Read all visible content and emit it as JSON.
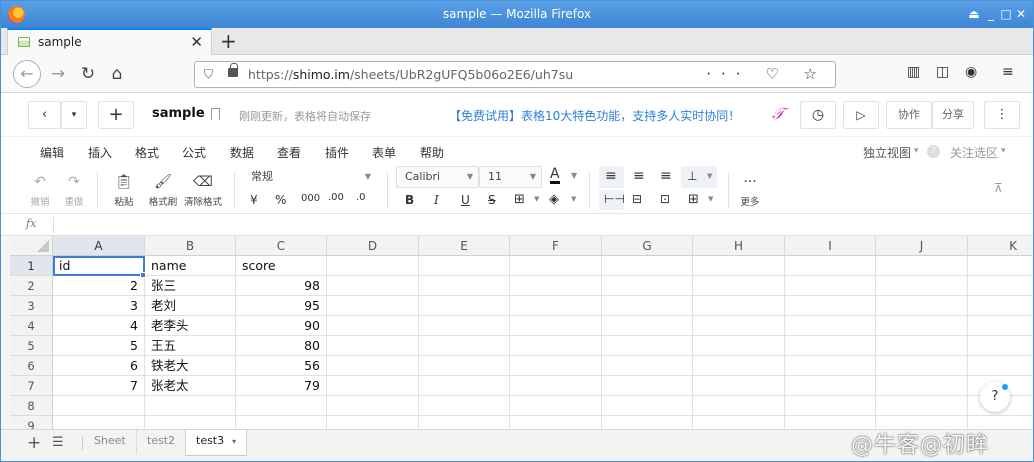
{
  "window": {
    "title": "sample — Mozilla Firefox",
    "controls": [
      "⏏",
      "_",
      "□",
      "✕"
    ]
  },
  "browser": {
    "tab": {
      "label": "sample",
      "close": "✕"
    },
    "new_tab": "+",
    "url_scheme": "https://",
    "url_host": "shimo.im",
    "url_path": "/sheets/UbR2gUFQ5b06o2E6/uh7su",
    "url_actions": "··· ♡ ☆"
  },
  "app": {
    "doc_title": "sample",
    "save_status": "刚刚更新，表格将自动保存",
    "promo": "【免费试用】表格10大特色功能，支持多人实时协同！",
    "logo_text": "𝒯",
    "collab_label": "协作",
    "share_label": "分享",
    "more_label": "⋮",
    "back_label": "‹",
    "dropdown_label": "▾",
    "add_label": "+"
  },
  "menu": {
    "items": [
      "编辑",
      "插入",
      "格式",
      "公式",
      "数据",
      "查看",
      "插件",
      "表单",
      "帮助"
    ],
    "right": {
      "view_mode": "独立视图",
      "view_arrow": "▾",
      "help_q": "?",
      "focus_label": "关注选区",
      "focus_arrow": "▾"
    }
  },
  "toolbar": {
    "undo": "撤销",
    "redo": "重做",
    "paste": "粘贴",
    "format_painter": "格式刷",
    "clear_format": "清除格式",
    "number_format": "常规",
    "currency": "¥",
    "percent": "%",
    "thousands": "000",
    "dec_increase": ".00",
    "dec_decrease": ".0",
    "font_name": "Calibri",
    "font_size": "11",
    "text_color_letter": "A",
    "bold": "B",
    "italic": "I",
    "underline": "U",
    "strike": "S",
    "more_label": "更多",
    "more_icon": "···",
    "collapse": "⊼"
  },
  "formula": {
    "fx": "fx",
    "value": ""
  },
  "sheet": {
    "columns": [
      "A",
      "B",
      "C",
      "D",
      "E",
      "F",
      "G",
      "H",
      "I",
      "J",
      "K"
    ],
    "selected_column": "A",
    "selected_row": 1,
    "rows": [
      {
        "n": "1",
        "cells": [
          "id",
          "name",
          "score"
        ]
      },
      {
        "n": "2",
        "cells": [
          "2",
          "张三",
          "98"
        ]
      },
      {
        "n": "3",
        "cells": [
          "3",
          "老刘",
          "95"
        ]
      },
      {
        "n": "4",
        "cells": [
          "4",
          "老李头",
          "90"
        ]
      },
      {
        "n": "5",
        "cells": [
          "5",
          "王五",
          "80"
        ]
      },
      {
        "n": "6",
        "cells": [
          "6",
          "铁老大",
          "56"
        ]
      },
      {
        "n": "7",
        "cells": [
          "7",
          "张老太",
          "79"
        ]
      },
      {
        "n": "8",
        "cells": [
          "",
          "",
          ""
        ]
      },
      {
        "n": "9",
        "cells": [
          "",
          "",
          ""
        ]
      }
    ]
  },
  "sheet_tabs": {
    "add": "+",
    "list": "☰",
    "tabs": [
      "Sheet",
      "test2",
      "test3"
    ],
    "active": "test3",
    "active_arrow": "▾"
  },
  "help_button": "?",
  "watermark": "@牛客@初眸",
  "colors": {
    "accent": "#3b7ed8",
    "promo": "#2d7fd8",
    "titlebar": "#3d86d4",
    "logo": "#d12fbf"
  }
}
